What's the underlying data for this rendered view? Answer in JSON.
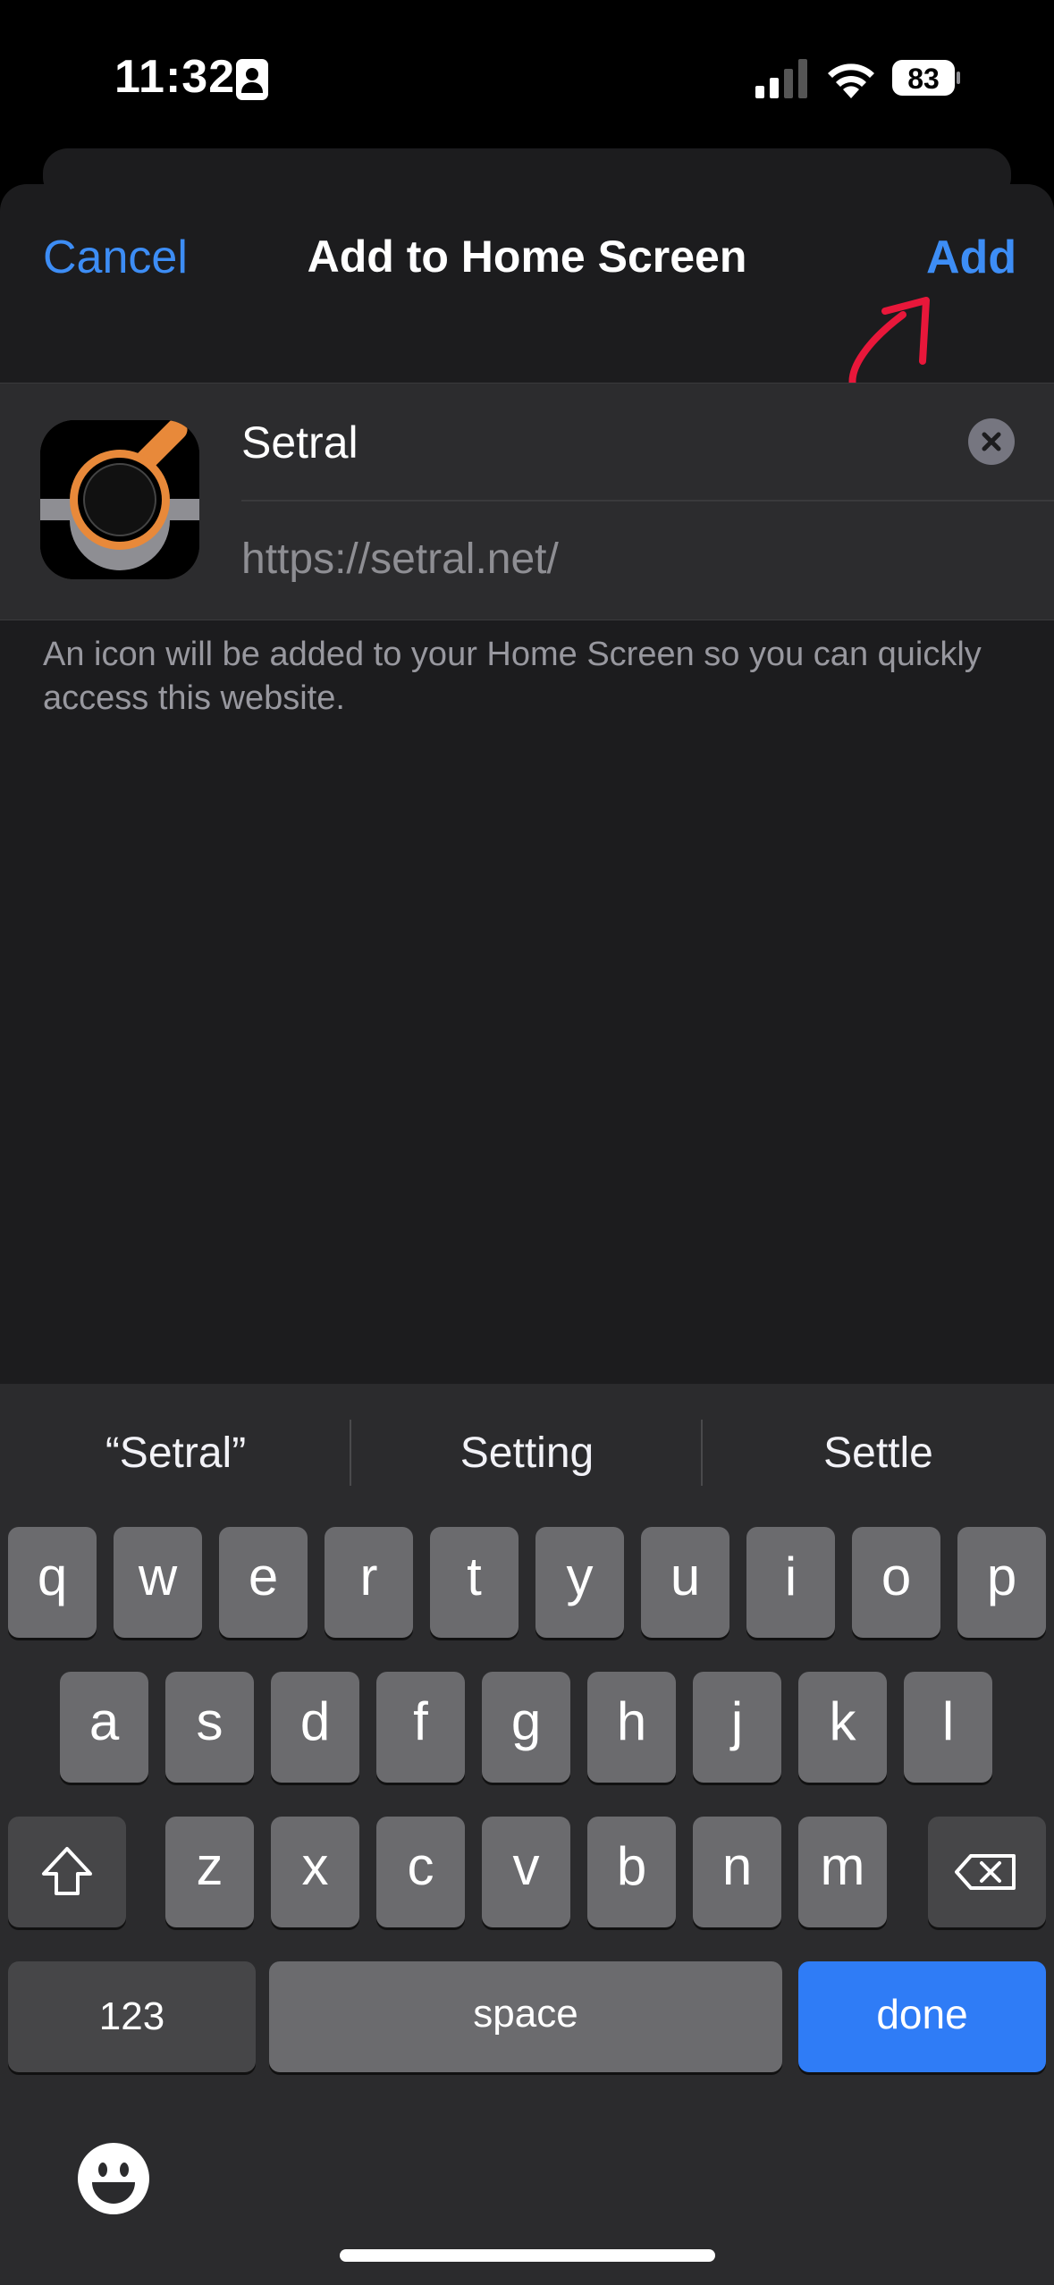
{
  "status_bar": {
    "time": "11:32",
    "battery": "83"
  },
  "nav": {
    "cancel": "Cancel",
    "title": "Add to Home Screen",
    "add": "Add"
  },
  "form": {
    "name_value": "Setral",
    "url_value": "https://setral.net/",
    "helper_text": "An icon will be added to your Home Screen so you can quickly access this website."
  },
  "keyboard": {
    "suggestions": [
      "“Setral”",
      "Setting",
      "Settle"
    ],
    "row1": [
      "q",
      "w",
      "e",
      "r",
      "t",
      "y",
      "u",
      "i",
      "o",
      "p"
    ],
    "row2": [
      "a",
      "s",
      "d",
      "f",
      "g",
      "h",
      "j",
      "k",
      "l"
    ],
    "row3": [
      "z",
      "x",
      "c",
      "v",
      "b",
      "n",
      "m"
    ],
    "numbers_label": "123",
    "space_label": "space",
    "done_label": "done"
  },
  "colors": {
    "accent": "#3d8df5",
    "done_key": "#2f7cf6",
    "annotation": "#e8173a",
    "icon_orange": "#e8893a"
  }
}
